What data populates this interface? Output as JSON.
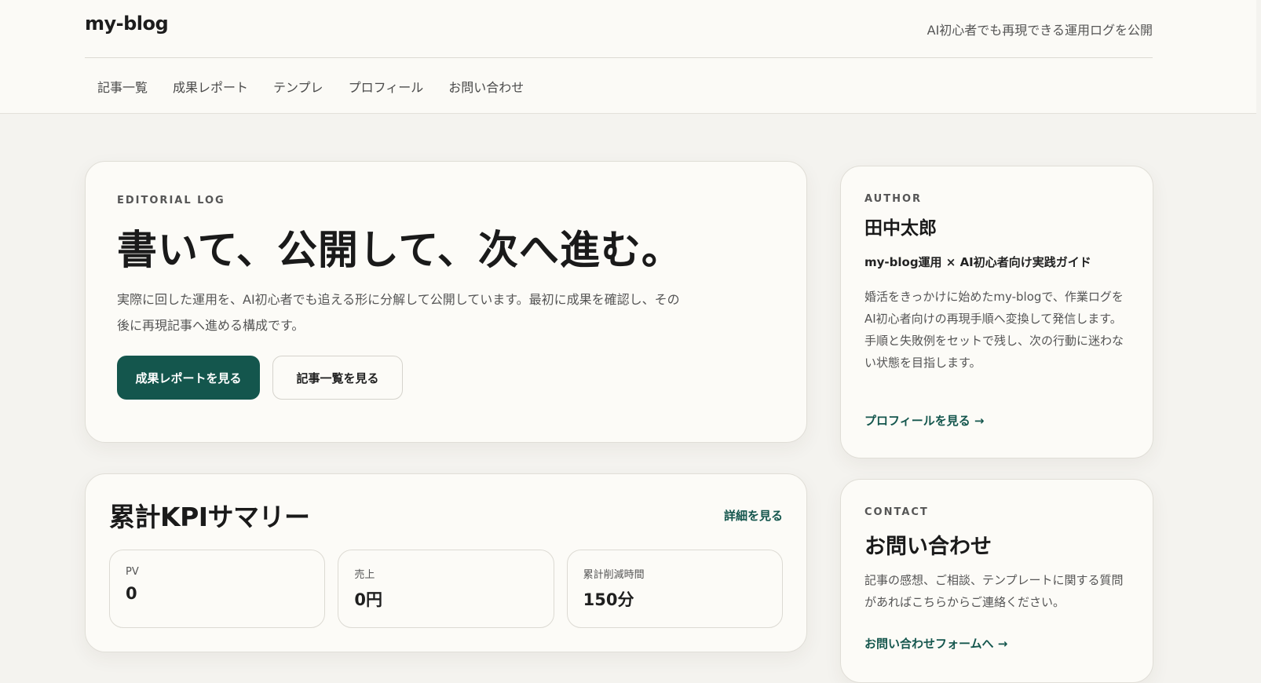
{
  "header": {
    "brand": "my-blog",
    "tagline": "AI初心者でも再現できる運用ログを公開",
    "nav": [
      "記事一覧",
      "成果レポート",
      "テンプレ",
      "プロフィール",
      "お問い合わせ"
    ]
  },
  "hero": {
    "eyebrow": "EDITORIAL LOG",
    "title": "書いて、公開して、次へ進む。",
    "description": "実際に回した運用を、AI初心者でも追える形に分解して公開しています。最初に成果を確認し、その後に再現記事へ進める構成です。",
    "primary_button": "成果レポートを見る",
    "secondary_button": "記事一覧を見る"
  },
  "kpi": {
    "title": "累計KPIサマリー",
    "detail_link": "詳細を見る",
    "items": [
      {
        "label": "PV",
        "value": "0"
      },
      {
        "label": "売上",
        "value": "0円"
      },
      {
        "label": "累計削減時間",
        "value": "150分"
      }
    ]
  },
  "author": {
    "eyebrow": "AUTHOR",
    "name": "田中太郎",
    "role": "my-blog運用 × AI初心者向け実践ガイド",
    "bio": "婚活をきっかけに始めたmy-blogで、作業ログをAI初心者向けの再現手順へ変換して発信します。手順と失敗例をセットで残し、次の行動に迷わない状態を目指します。",
    "link": "プロフィールを見る →"
  },
  "contact": {
    "eyebrow": "CONTACT",
    "title": "お問い合わせ",
    "description": "記事の感想、ご相談、テンプレートに関する質問があればこちらからご連絡ください。",
    "link": "お問い合わせフォームへ →"
  },
  "colors": {
    "accent": "#14564d",
    "background": "#f4f3ef",
    "card": "#fcfbf7"
  }
}
